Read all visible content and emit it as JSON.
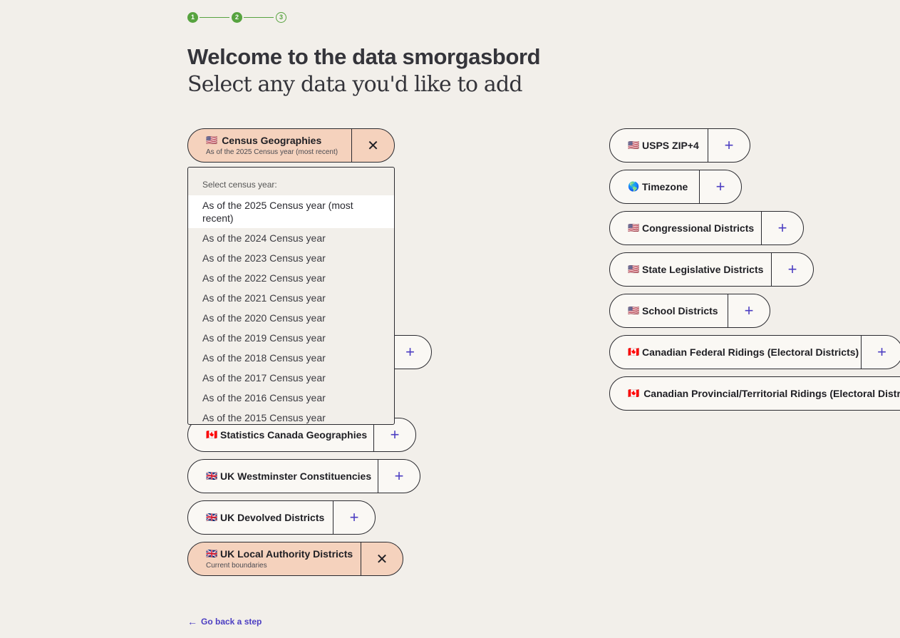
{
  "stepper": {
    "steps": [
      "1",
      "2",
      "3"
    ],
    "current": 2
  },
  "header": {
    "title": "Welcome to the data smorgasbord",
    "subtitle": "Select any data you'd like to add"
  },
  "left_options": [
    {
      "flag": "🇺🇸",
      "label": "Census Geographies",
      "sublabel": "As of the 2025 Census year (most recent)",
      "selected": true,
      "action_icon": "close-icon",
      "action_glyph": "✕"
    },
    {
      "flag": "",
      "label": "",
      "sublabel": "",
      "selected": false,
      "action_icon": "plus-icon",
      "action_glyph": "+"
    },
    {
      "flag": "🇨🇦",
      "label": "Statistics Canada Geographies",
      "sublabel": "",
      "selected": false,
      "action_icon": "plus-icon",
      "action_glyph": "+"
    },
    {
      "flag": "🇬🇧",
      "label": "UK Westminster Constituencies",
      "sublabel": "",
      "selected": false,
      "action_icon": "plus-icon",
      "action_glyph": "+"
    },
    {
      "flag": "🇬🇧",
      "label": "UK Devolved Districts",
      "sublabel": "",
      "selected": false,
      "action_icon": "plus-icon",
      "action_glyph": "+"
    },
    {
      "flag": "🇬🇧",
      "label": "UK Local Authority Districts",
      "sublabel": "Current boundaries",
      "selected": true,
      "action_icon": "close-icon",
      "action_glyph": "✕"
    }
  ],
  "right_options": [
    {
      "flag": "🇺🇸",
      "label": "USPS ZIP+4",
      "action_glyph": "+"
    },
    {
      "flag": "🌎",
      "label": "Timezone",
      "action_glyph": "+"
    },
    {
      "flag": "🇺🇸",
      "label": "Congressional Districts",
      "action_glyph": "+"
    },
    {
      "flag": "🇺🇸",
      "label": "State Legislative Districts",
      "action_glyph": "+"
    },
    {
      "flag": "🇺🇸",
      "label": "School Districts",
      "action_glyph": "+"
    },
    {
      "flag": "🇨🇦",
      "label": "Canadian Federal Ridings (Electoral Districts)",
      "action_glyph": "+"
    },
    {
      "flag": "🇨🇦",
      "label": "Canadian Provincial/Territorial Ridings (Electoral Districts)",
      "action_glyph": "+"
    }
  ],
  "census_year_dropdown": {
    "label": "Select census year:",
    "selected": "As of the 2025 Census year (most recent)",
    "options": [
      "As of the 2025 Census year (most recent)",
      "As of the 2024 Census year",
      "As of the 2023 Census year",
      "As of the 2022 Census year",
      "As of the 2021 Census year",
      "As of the 2020 Census year",
      "As of the 2019 Census year",
      "As of the 2018 Census year",
      "As of the 2017 Census year",
      "As of the 2016 Census year",
      "As of the 2015 Census year"
    ]
  },
  "footer": {
    "back_label": "Go back a step",
    "back_icon": "arrow-left-icon"
  },
  "colors": {
    "background": "#f2efea",
    "selected_pill": "#f5d2bd",
    "accent": "#4c3ec2",
    "step_green": "#57a33f"
  }
}
